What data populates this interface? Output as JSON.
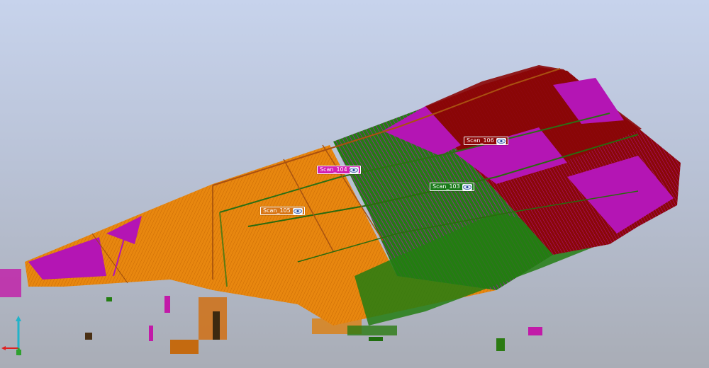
{
  "viewer": {
    "background_top": "#c7d3ec",
    "background_bottom": "#a9adb6"
  },
  "scans": [
    {
      "label": "Scan_104",
      "color": "#d21fb2",
      "icon": "eye-icon"
    },
    {
      "label": "Scan_105",
      "color": "#d87616",
      "icon": "eye-icon"
    },
    {
      "label": "Scan_103",
      "color": "#1a7a1a",
      "icon": "eye-icon"
    },
    {
      "label": "Scan_106",
      "color": "#8e0606",
      "icon": "eye-icon"
    }
  ],
  "point_colors": {
    "orange": "#e8870f",
    "magenta": "#b415b4",
    "green": "#237d12",
    "darkred": "#8a0707"
  },
  "axis_gizmo": {
    "x_color": "#e02020",
    "y_color": "#2fa02f",
    "z_color": "#22b3c9"
  }
}
